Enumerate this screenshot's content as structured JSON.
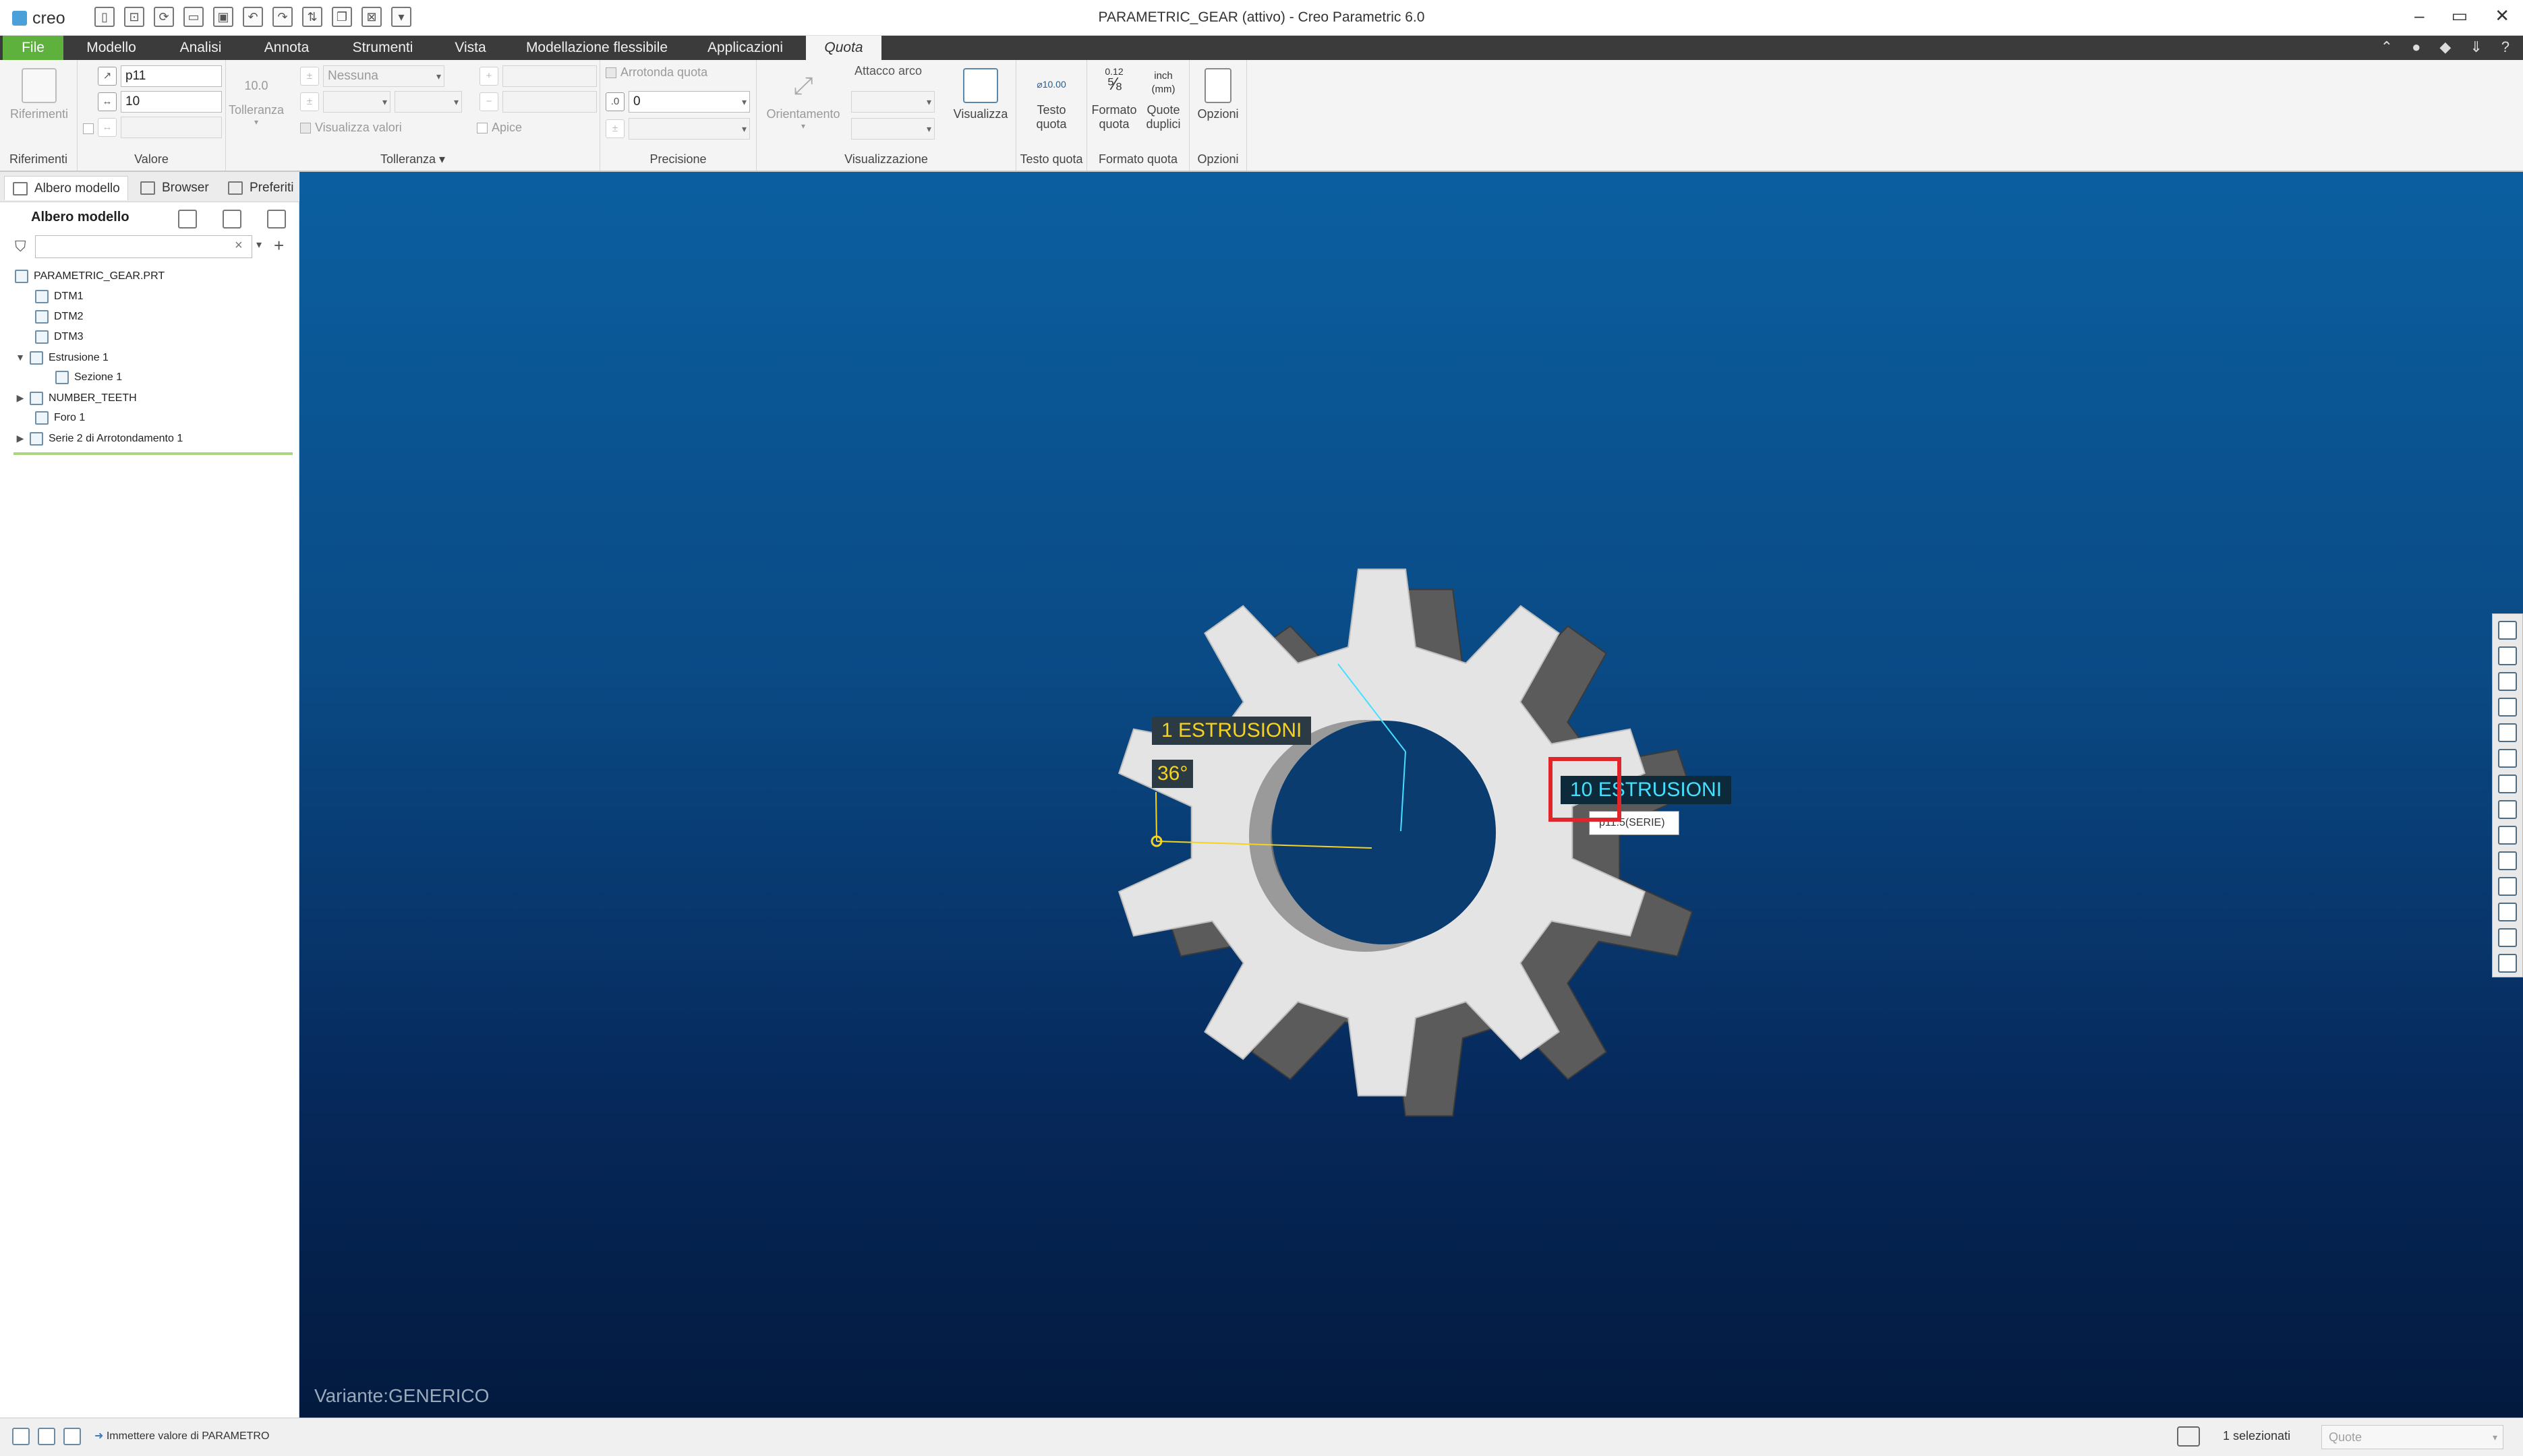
{
  "app": {
    "logo": "creo",
    "title": "PARAMETRIC_GEAR (attivo) - Creo Parametric 6.0",
    "window_controls": [
      "–",
      "▭",
      "✕"
    ]
  },
  "tabs": [
    {
      "label": "File"
    },
    {
      "label": "Modello"
    },
    {
      "label": "Analisi"
    },
    {
      "label": "Annota"
    },
    {
      "label": "Strumenti"
    },
    {
      "label": "Vista"
    },
    {
      "label": "Modellazione flessibile"
    },
    {
      "label": "Applicazioni"
    },
    {
      "label": "Quota"
    }
  ],
  "ribbon": {
    "riferimenti": {
      "button": "Riferimenti",
      "group": "Riferimenti"
    },
    "valore": {
      "name_value": "p11",
      "value": "10",
      "group": "Valore"
    },
    "tolleranza": {
      "button": "Tolleranza",
      "icon_text": "10.0",
      "select": "Nessuna",
      "check_label": "Visualizza valori",
      "apex_label": "Apice",
      "group": "Tolleranza ▾"
    },
    "precisione": {
      "round_label": "Arrotonda quota",
      "decimals": "0",
      "group": "Precisione"
    },
    "visualizzazione": {
      "orient": "Orientamento",
      "arc": "Attacco arco",
      "show": "Visualizza",
      "group": "Visualizzazione"
    },
    "testo": {
      "icon_text": "⌀10.00",
      "button_1": "Testo",
      "button_2": "quota",
      "group": "Testo quota"
    },
    "formato": {
      "fmt_top": "0.12",
      "fmt_frac": "⅝",
      "unit_1": "inch",
      "unit_2": "(mm)",
      "b1a": "Formato",
      "b1b": "quota",
      "b2a": "Quote",
      "b2b": "duplici",
      "group": "Formato quota"
    },
    "opzioni": {
      "button": "Opzioni",
      "group": "Opzioni"
    }
  },
  "panel": {
    "tabs": [
      "Albero modello",
      "Browser",
      "Preferiti"
    ],
    "tree_title": "Albero modello",
    "filter_placeholder": "",
    "tree": [
      {
        "label": "PARAMETRIC_GEAR.PRT"
      },
      {
        "label": "DTM1"
      },
      {
        "label": "DTM2"
      },
      {
        "label": "DTM3"
      },
      {
        "label": "Estrusione 1",
        "expander": "▼"
      },
      {
        "label": "Sezione 1"
      },
      {
        "label": "NUMBER_TEETH",
        "expander": "▶"
      },
      {
        "label": "Foro 1"
      },
      {
        "label": "Serie 2 di Arrotondamento 1",
        "expander": "▶"
      }
    ]
  },
  "viewport": {
    "annotations": {
      "estrusioni_1": "1 ESTRUSIONI",
      "angle": "36°",
      "estrusioni_10": "10 ESTRUSIONI",
      "tooltip": "p11:5(SERIE)"
    },
    "variant": "Variante:GENERICO"
  },
  "status": {
    "message": "Immettere valore di PARAMETRO",
    "selected": "1 selezionati",
    "filter": "Quote"
  },
  "colors": {
    "file_tab": "#5fb13d",
    "ribbon_dark": "#3b3b3b",
    "highlight": "#e0262a",
    "annotation_yellow": "#f6d321",
    "annotation_cyan": "#45e0ff"
  }
}
